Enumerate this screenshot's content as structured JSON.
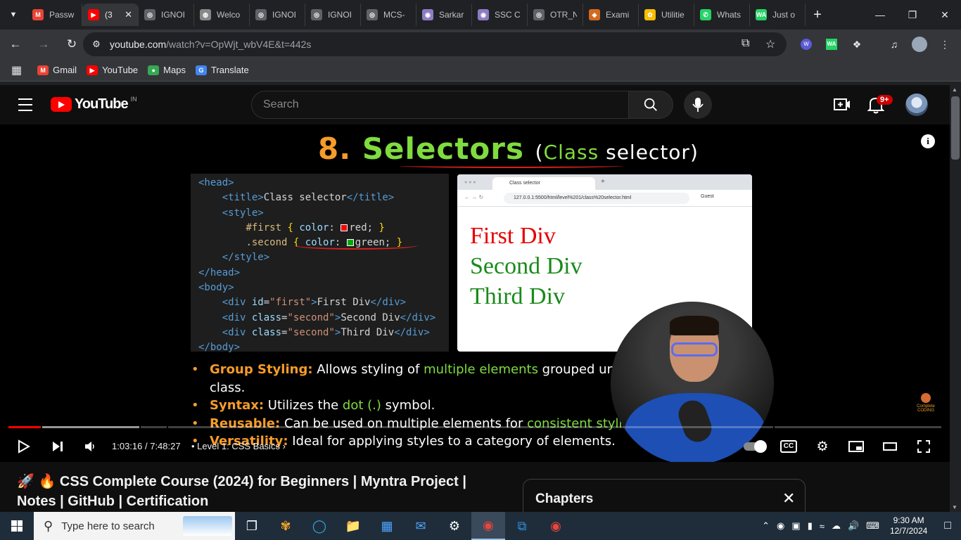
{
  "tabs": [
    {
      "title": "Passw",
      "favicon": "gmail-icon",
      "color": "#ea4335",
      "glyph": "M"
    },
    {
      "title": "(3",
      "favicon": "youtube-icon",
      "color": "#ff0000",
      "glyph": "▶",
      "active": true
    },
    {
      "title": "IGNOI",
      "favicon": "globe-icon",
      "color": "#5f6368",
      "glyph": "◎"
    },
    {
      "title": "Welco",
      "favicon": "ignou-icon",
      "color": "#888888",
      "glyph": "◍"
    },
    {
      "title": "IGNOI",
      "favicon": "globe-icon",
      "color": "#5f6368",
      "glyph": "◎"
    },
    {
      "title": "IGNOI",
      "favicon": "globe-icon",
      "color": "#5f6368",
      "glyph": "◎"
    },
    {
      "title": "MCS-",
      "favicon": "globe-icon",
      "color": "#5f6368",
      "glyph": "◎"
    },
    {
      "title": "Sarkar",
      "favicon": "sarkari-icon",
      "color": "#8e7cc3",
      "glyph": "◉"
    },
    {
      "title": "SSC C",
      "favicon": "ssc-icon",
      "color": "#8e7cc3",
      "glyph": "◉"
    },
    {
      "title": "OTR_N",
      "favicon": "globe-icon",
      "color": "#5f6368",
      "glyph": "◎"
    },
    {
      "title": "Exami",
      "favicon": "exam-icon",
      "color": "#d2691e",
      "glyph": "◈"
    },
    {
      "title": "Utilitie",
      "favicon": "photos-icon",
      "color": "#fbbc04",
      "glyph": "✿"
    },
    {
      "title": "Whats",
      "favicon": "whatsapp-icon",
      "color": "#25d366",
      "glyph": "✆"
    },
    {
      "title": "Just o",
      "favicon": "wa-icon",
      "color": "#25d366",
      "glyph": "WA"
    }
  ],
  "address": {
    "host": "youtube.com",
    "path": "/watch?v=OpWjt_wbV4E&t=442s"
  },
  "bookmarks": [
    {
      "label": "Gmail",
      "color": "#ea4335",
      "glyph": "M",
      "icon": "gmail-icon"
    },
    {
      "label": "YouTube",
      "color": "#ff0000",
      "glyph": "▶",
      "icon": "youtube-icon"
    },
    {
      "label": "Maps",
      "color": "#34a853",
      "glyph": "●",
      "icon": "maps-icon"
    },
    {
      "label": "Translate",
      "color": "#4285f4",
      "glyph": "G",
      "icon": "translate-icon"
    }
  ],
  "youtube": {
    "logo_text": "YouTube",
    "country": "IN",
    "search_placeholder": "Search",
    "notif_badge": "9+"
  },
  "slide": {
    "num": "8.",
    "heading": "Selectors",
    "paren_open": "(",
    "class_word": "Class",
    "selector_word": "selector",
    "paren_close": ")",
    "code_lines": [
      "<head>",
      "    <title>Class selector</title>",
      "    <style>",
      "        #first { color: red; }",
      "        .second { color: green; }",
      "    </style>",
      "</head>",
      "<body>",
      "    <div id=\"first\">First Div</div>",
      "    <div class=\"second\">Second Div</div>",
      "    <div class=\"second\">Third Div</div>",
      "</body>"
    ],
    "browser_tab": "Class selector",
    "browser_url": "127.0.0.1:5500/html/level%201/class%20selector.html",
    "browser_guest": "Guest",
    "div1": "First Div",
    "div2": "Second Div",
    "div3": "Third Div",
    "bullets": [
      {
        "key": "Group Styling",
        "pre": " Allows styling of ",
        "hl": "multiple elements",
        "post": " grouped under"
      },
      {
        "cont": "class."
      },
      {
        "key": "Syntax",
        "pre": " Utilizes the ",
        "hl": "dot (.)",
        "post": " symbol."
      },
      {
        "key": "Reusable",
        "pre": " Can be used on multiple elements for ",
        "hl": "consistent styling",
        "post": "."
      },
      {
        "key": "Versatility",
        "pre": " Ideal for applying styles to a category of elements.",
        "hl": "",
        "post": ""
      }
    ],
    "watermark": "Complete CODING"
  },
  "player": {
    "time": "1:03:16 / 7:48:27",
    "chapter": "Level 1: CSS Basics",
    "progress_played": 0.035,
    "progress_buffered": 0.14
  },
  "video": {
    "title": "🚀 🔥 CSS Complete Course (2024) for Beginners | Myntra Project | Notes | GitHub | Certification",
    "chapters_label": "Chapters"
  },
  "taskbar": {
    "search_placeholder": "Type here to search",
    "time": "9:30 AM",
    "date": "12/7/2024"
  }
}
